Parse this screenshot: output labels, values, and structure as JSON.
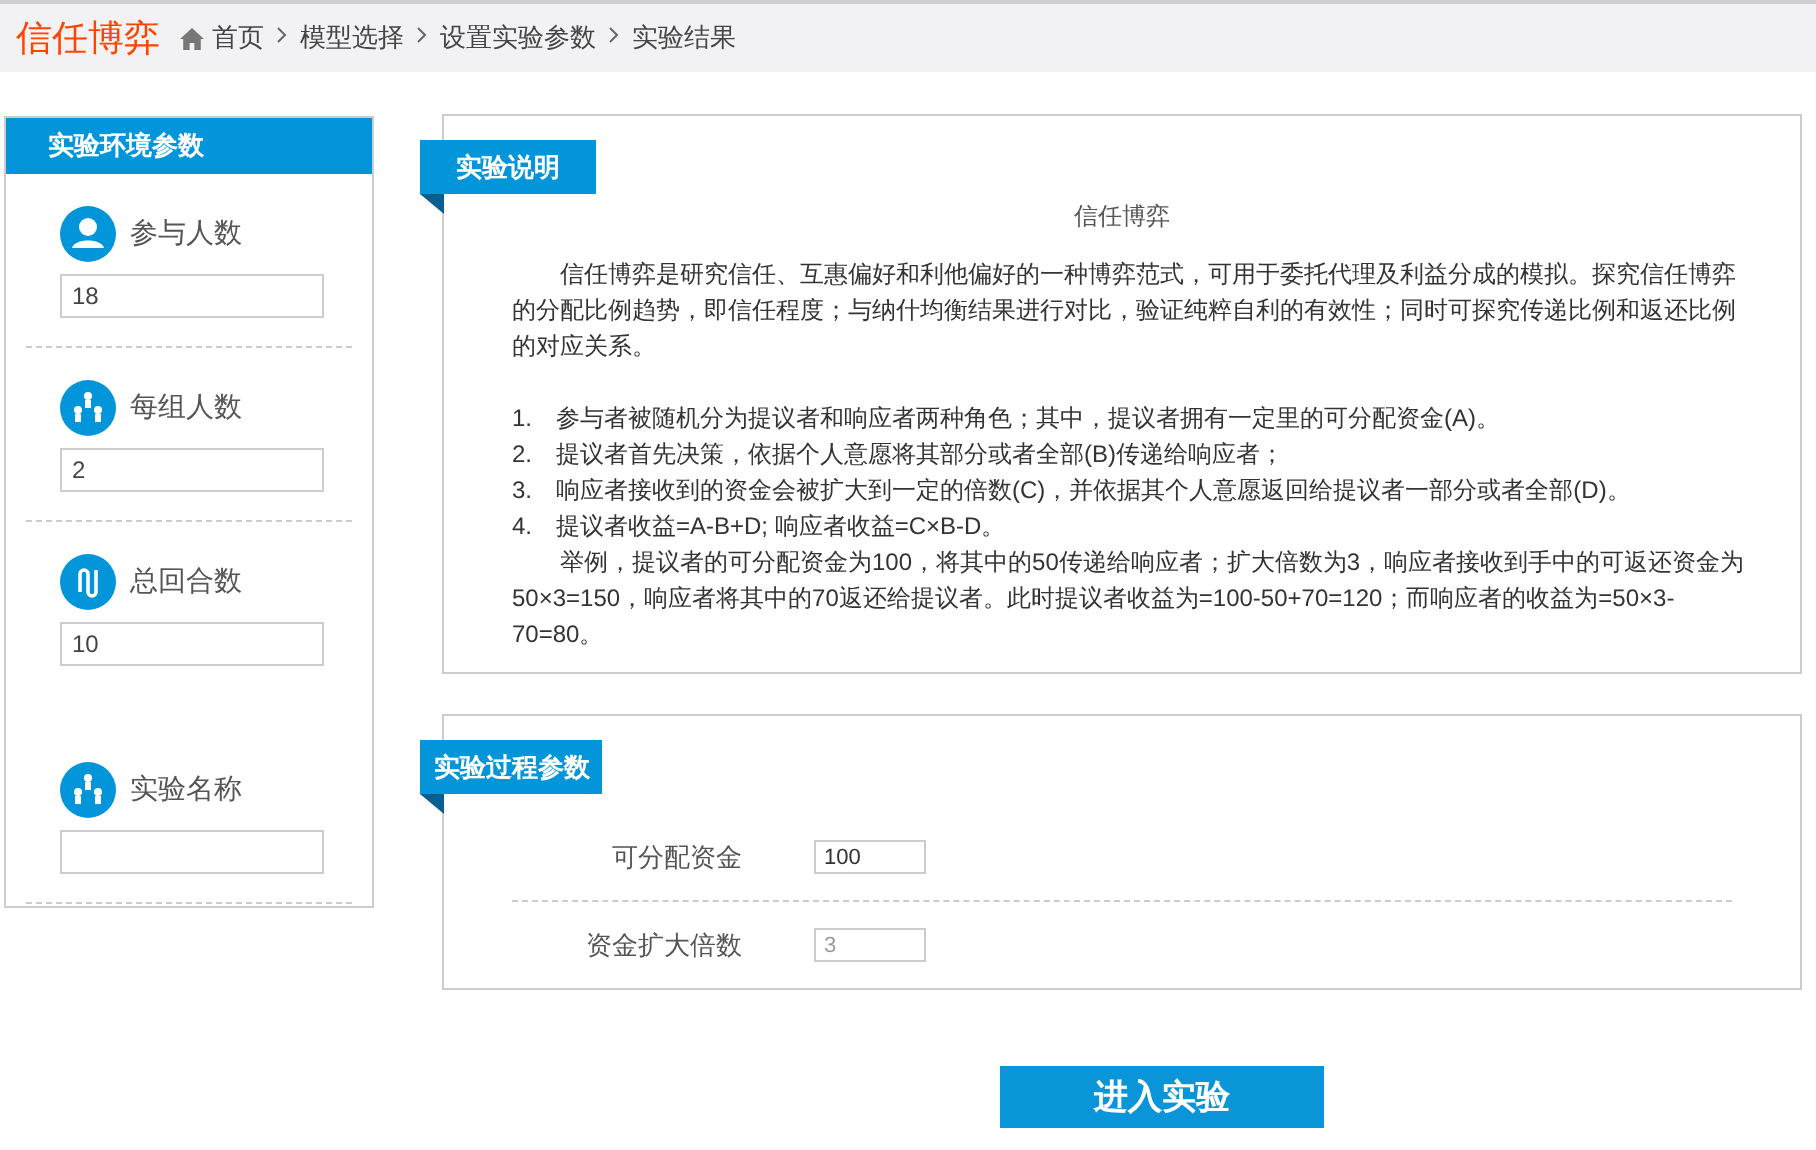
{
  "header": {
    "logo": "信任博弈",
    "breadcrumb": [
      "首页",
      "模型选择",
      "设置实验参数",
      "实验结果"
    ]
  },
  "sidebar": {
    "title": "实验环境参数",
    "items": [
      {
        "kind": "person",
        "label": "参与人数",
        "value": "18"
      },
      {
        "kind": "group",
        "label": "每组人数",
        "value": "2"
      },
      {
        "kind": "clip",
        "label": "总回合数",
        "value": "10"
      },
      {
        "kind": "group",
        "label": "实验名称",
        "value": ""
      }
    ]
  },
  "description": {
    "ribbon": "实验说明",
    "title": "信任博弈",
    "paragraphs": [
      {
        "kind": "para",
        "text": "信任博弈是研究信任、互惠偏好和利他偏好的一种博弈范式，可用于委托代理及利益分成的模拟。探究信任博弈的分配比例趋势，即信任程度；与纳什均衡结果进行对比，验证纯粹自利的有效性；同时可探究传递比例和返还比例的对应关系。"
      },
      {
        "kind": "item",
        "number": "1.",
        "text": "参与者被随机分为提议者和响应者两种角色；其中，提议者拥有一定里的可分配资金(A)。"
      },
      {
        "kind": "item",
        "number": "2.",
        "text": "提议者首先决策，依据个人意愿将其部分或者全部(B)传递给响应者；"
      },
      {
        "kind": "item",
        "number": "3.",
        "text": "响应者接收到的资金会被扩大到一定的倍数(C)，并依据其个人意愿返回给提议者一部分或者全部(D)。"
      },
      {
        "kind": "item",
        "number": "4.",
        "text": "提议者收益=A-B+D; 响应者收益=C×B-D。"
      },
      {
        "kind": "para",
        "text": "举例，提议者的可分配资金为100，将其中的50传递给响应者；扩大倍数为3，响应者接收到手中的可返还资金为50×3=150，响应者将其中的70返还给提议者。此时提议者收益为=100-50+70=120；而响应者的收益为=50×3-70=80。"
      }
    ]
  },
  "process": {
    "ribbon": "实验过程参数",
    "fields": [
      {
        "label": "可分配资金",
        "value": "100",
        "disabled": false
      },
      {
        "label": "资金扩大倍数",
        "value": "3",
        "disabled": true
      }
    ]
  },
  "button": "进入实验"
}
